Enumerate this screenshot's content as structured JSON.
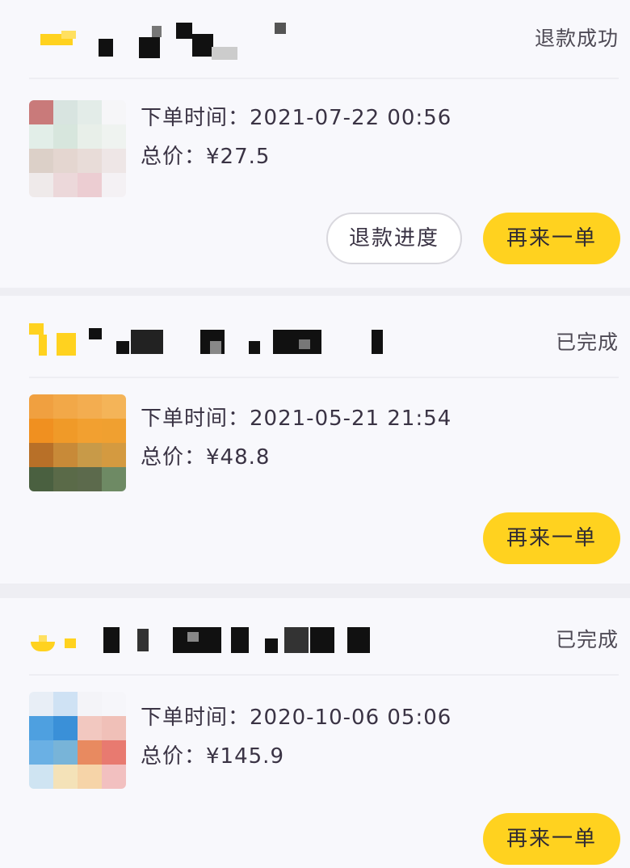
{
  "colors": {
    "accent": "#ffd21f",
    "page_background": "#eeeef3",
    "card_background": "#f8f8fc",
    "text": "#3a3344"
  },
  "orders": [
    {
      "status": "退款成功",
      "time_label": "下单时间：",
      "time_value": "2021-07-22 00:56",
      "price_label": "总价：",
      "price_value": "¥27.5",
      "secondary_button": "退款进度",
      "primary_button": "再来一单"
    },
    {
      "status": "已完成",
      "time_label": "下单时间：",
      "time_value": "2021-05-21 21:54",
      "price_label": "总价：",
      "price_value": "¥48.8",
      "primary_button": "再来一单"
    },
    {
      "status": "已完成",
      "time_label": "下单时间：",
      "time_value": "2020-10-06 05:06",
      "price_label": "总价：",
      "price_value": "¥145.9",
      "primary_button": "再来一单"
    }
  ]
}
